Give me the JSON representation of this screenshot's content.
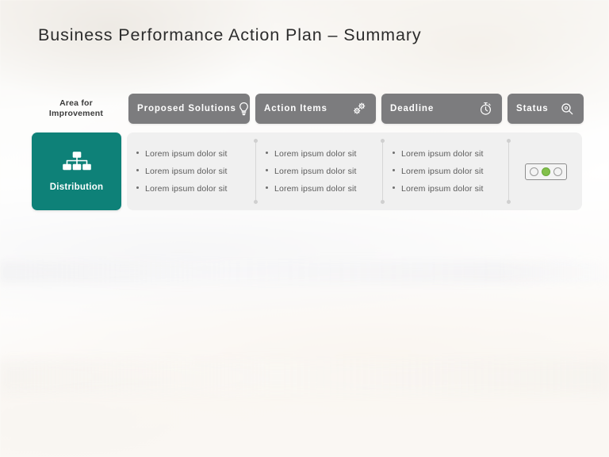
{
  "slide": {
    "title": "Business Performance Action Plan – Summary",
    "accent_teal": "#0e8178",
    "header_gray": "#7c7c7e",
    "panel_gray": "#f0f0f0",
    "status_green": "#82c04a"
  },
  "area_caption": {
    "line1": "Area for",
    "line2": "Improvement"
  },
  "headers": [
    {
      "label": "Proposed Solutions",
      "icon": "lightbulb-icon"
    },
    {
      "label": "Action Items",
      "icon": "gears-icon"
    },
    {
      "label": "Deadline",
      "icon": "stopwatch-icon"
    },
    {
      "label": "Status",
      "icon": "magnifier-icon"
    }
  ],
  "category": {
    "label": "Distribution",
    "icon": "org-chart-icon"
  },
  "columns": {
    "proposed_solutions": [
      "Lorem ipsum dolor sit",
      "Lorem ipsum dolor sit",
      "Lorem ipsum dolor sit"
    ],
    "action_items": [
      "Lorem ipsum dolor sit",
      "Lorem ipsum dolor sit",
      "Lorem ipsum dolor sit"
    ],
    "deadline": [
      "Lorem ipsum dolor sit",
      "Lorem ipsum dolor sit",
      "Lorem ipsum dolor sit"
    ]
  },
  "status": {
    "lights": [
      "off",
      "on",
      "off"
    ],
    "active_index": 1
  }
}
